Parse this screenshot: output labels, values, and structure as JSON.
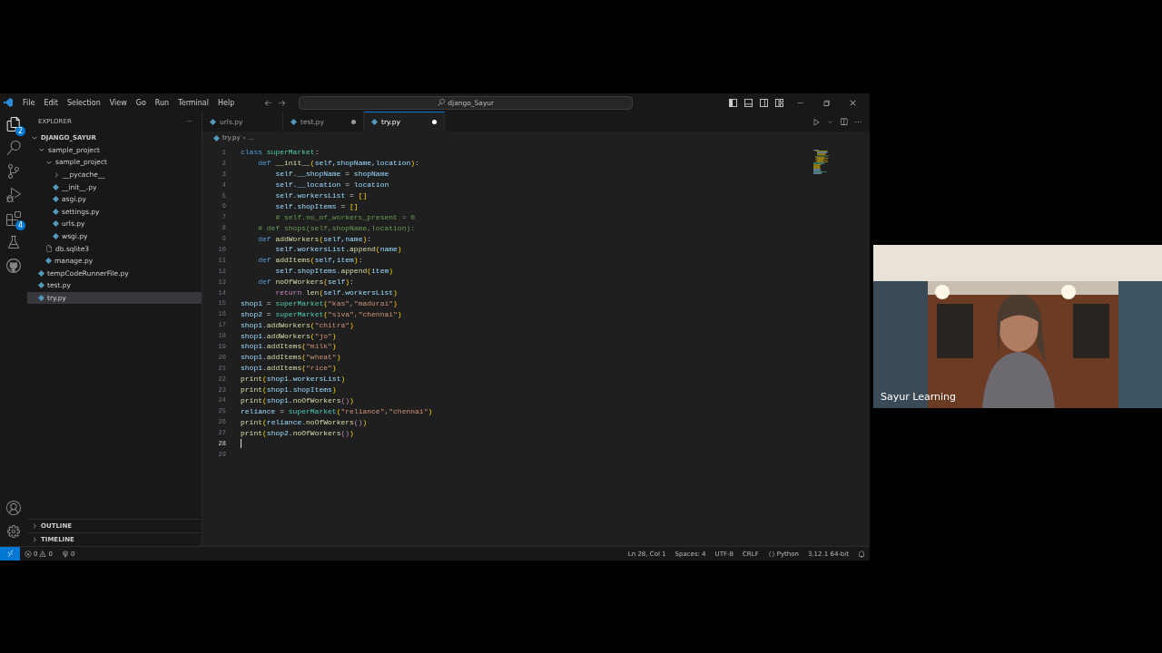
{
  "menu": [
    "File",
    "Edit",
    "Selection",
    "View",
    "Go",
    "Run",
    "Terminal",
    "Help"
  ],
  "command_center": {
    "value": "django_Sayur"
  },
  "activity_bar": [
    {
      "kind": "files",
      "selected": true,
      "badge": "2"
    },
    {
      "kind": "search",
      "selected": false
    },
    {
      "kind": "source-control",
      "selected": false
    },
    {
      "kind": "run-debug",
      "selected": false
    },
    {
      "kind": "extensions",
      "selected": false,
      "badge": "4"
    },
    {
      "kind": "testing",
      "selected": false
    },
    {
      "kind": "github",
      "selected": false
    }
  ],
  "explorer": {
    "title": "EXPLORER",
    "more": "···",
    "tree": [
      {
        "label": "DJANGO_SAYUR",
        "kind": "root",
        "expanded": true,
        "selected": false,
        "children": [
          {
            "label": "sample_project",
            "kind": "folder",
            "expanded": true,
            "selected": false,
            "children": [
              {
                "label": "sample_project",
                "kind": "folder",
                "expanded": true,
                "selected": false,
                "children": [
                  {
                    "label": "__pycache__",
                    "kind": "folder",
                    "expanded": false,
                    "selected": false
                  },
                  {
                    "label": "__init__.py",
                    "kind": "py",
                    "selected": false
                  },
                  {
                    "label": "asgi.py",
                    "kind": "py",
                    "selected": false
                  },
                  {
                    "label": "settings.py",
                    "kind": "py",
                    "selected": false
                  },
                  {
                    "label": "urls.py",
                    "kind": "py",
                    "selected": false
                  },
                  {
                    "label": "wsgi.py",
                    "kind": "py",
                    "selected": false
                  }
                ]
              },
              {
                "label": "db.sqlite3",
                "kind": "db",
                "selected": false
              },
              {
                "label": "manage.py",
                "kind": "py",
                "selected": false
              }
            ]
          },
          {
            "label": "tempCodeRunnerFile.py",
            "kind": "py",
            "selected": false
          },
          {
            "label": "test.py",
            "kind": "py",
            "selected": false
          },
          {
            "label": "try.py",
            "kind": "py",
            "selected": true
          }
        ]
      }
    ]
  },
  "sections": [
    {
      "label": "OUTLINE",
      "expanded": false
    },
    {
      "label": "TIMELINE",
      "expanded": false
    }
  ],
  "tabs": [
    {
      "label": "urls.py",
      "selected": false,
      "dirty": false
    },
    {
      "label": "test.py",
      "selected": false,
      "dirty": true
    },
    {
      "label": "try.py",
      "selected": true,
      "dirty": true
    }
  ],
  "breadcrumb": [
    "try.py",
    "›",
    "..."
  ],
  "code": [
    {
      "number": "1",
      "current": false,
      "tokens": [
        {
          "kind": "kw",
          "text": "class "
        },
        {
          "kind": "cls",
          "text": "superMarket"
        },
        {
          "kind": "plain",
          "text": ":"
        }
      ]
    },
    {
      "number": "2",
      "current": false,
      "tokens": [
        {
          "kind": "kw",
          "text": "    def "
        },
        {
          "kind": "fn",
          "text": "__init__"
        },
        {
          "kind": "br",
          "text": "("
        },
        {
          "kind": "var",
          "text": "self,shopName,location"
        },
        {
          "kind": "br",
          "text": ")"
        },
        {
          "kind": "plain",
          "text": ":"
        }
      ]
    },
    {
      "number": "3",
      "current": false,
      "tokens": [
        {
          "kind": "var",
          "text": "        self.__shopName"
        },
        {
          "kind": "plain",
          "text": " = "
        },
        {
          "kind": "var",
          "text": "shopName"
        }
      ]
    },
    {
      "number": "4",
      "current": false,
      "tokens": [
        {
          "kind": "var",
          "text": "        self.__location"
        },
        {
          "kind": "plain",
          "text": " = "
        },
        {
          "kind": "var",
          "text": "location"
        }
      ]
    },
    {
      "number": "5",
      "current": false,
      "tokens": [
        {
          "kind": "var",
          "text": "        self.workersList"
        },
        {
          "kind": "plain",
          "text": " = "
        },
        {
          "kind": "br",
          "text": "[]"
        }
      ]
    },
    {
      "number": "6",
      "current": false,
      "tokens": [
        {
          "kind": "var",
          "text": "        self.shopItems"
        },
        {
          "kind": "plain",
          "text": " = "
        },
        {
          "kind": "br",
          "text": "[]"
        }
      ]
    },
    {
      "number": "7",
      "current": false,
      "tokens": [
        {
          "kind": "comment",
          "text": "        # self.no_of_workers_present = 0"
        }
      ]
    },
    {
      "number": "8",
      "current": false,
      "tokens": [
        {
          "kind": "comment",
          "text": "    # def shops(self,shopName,location):"
        }
      ]
    },
    {
      "number": "9",
      "current": false,
      "tokens": [
        {
          "kind": "kw",
          "text": "    def "
        },
        {
          "kind": "fn",
          "text": "addWorkers"
        },
        {
          "kind": "br",
          "text": "("
        },
        {
          "kind": "var",
          "text": "self,name"
        },
        {
          "kind": "br",
          "text": ")"
        },
        {
          "kind": "plain",
          "text": ":"
        }
      ]
    },
    {
      "number": "10",
      "current": false,
      "tokens": [
        {
          "kind": "var",
          "text": "        self.workersList."
        },
        {
          "kind": "fn",
          "text": "append"
        },
        {
          "kind": "br",
          "text": "("
        },
        {
          "kind": "var",
          "text": "name"
        },
        {
          "kind": "br",
          "text": ")"
        }
      ]
    },
    {
      "number": "11",
      "current": false,
      "tokens": [
        {
          "kind": "kw",
          "text": "    def "
        },
        {
          "kind": "fn",
          "text": "addItems"
        },
        {
          "kind": "br",
          "text": "("
        },
        {
          "kind": "var",
          "text": "self,item"
        },
        {
          "kind": "br",
          "text": ")"
        },
        {
          "kind": "plain",
          "text": ":"
        }
      ]
    },
    {
      "number": "12",
      "current": false,
      "tokens": [
        {
          "kind": "var",
          "text": "        self.shopItems."
        },
        {
          "kind": "fn",
          "text": "append"
        },
        {
          "kind": "br",
          "text": "("
        },
        {
          "kind": "var",
          "text": "item"
        },
        {
          "kind": "br",
          "text": ")"
        }
      ]
    },
    {
      "number": "13",
      "current": false,
      "tokens": [
        {
          "kind": "kw",
          "text": "    def "
        },
        {
          "kind": "fn",
          "text": "noOfWorkers"
        },
        {
          "kind": "br",
          "text": "("
        },
        {
          "kind": "var",
          "text": "self"
        },
        {
          "kind": "br",
          "text": ")"
        },
        {
          "kind": "plain",
          "text": ":"
        }
      ]
    },
    {
      "number": "14",
      "current": false,
      "tokens": [
        {
          "kind": "ctl",
          "text": "        return "
        },
        {
          "kind": "fn",
          "text": "len"
        },
        {
          "kind": "br",
          "text": "("
        },
        {
          "kind": "var",
          "text": "self.workersList"
        },
        {
          "kind": "br",
          "text": ")"
        }
      ]
    },
    {
      "number": "15",
      "current": false,
      "tokens": [
        {
          "kind": "var",
          "text": "shop1"
        },
        {
          "kind": "plain",
          "text": " = "
        },
        {
          "kind": "cls",
          "text": "superMarket"
        },
        {
          "kind": "br",
          "text": "("
        },
        {
          "kind": "str",
          "text": "\"kas\",\"madurai\""
        },
        {
          "kind": "br",
          "text": ")"
        }
      ]
    },
    {
      "number": "16",
      "current": false,
      "tokens": [
        {
          "kind": "var",
          "text": "shop2"
        },
        {
          "kind": "plain",
          "text": " = "
        },
        {
          "kind": "cls",
          "text": "superMarket"
        },
        {
          "kind": "br",
          "text": "("
        },
        {
          "kind": "str",
          "text": "\"siva\",\"chennai\""
        },
        {
          "kind": "br",
          "text": ")"
        }
      ]
    },
    {
      "number": "17",
      "current": false,
      "tokens": [
        {
          "kind": "var",
          "text": "shop1."
        },
        {
          "kind": "fn",
          "text": "addWorkers"
        },
        {
          "kind": "br",
          "text": "("
        },
        {
          "kind": "str",
          "text": "\"chitra\""
        },
        {
          "kind": "br",
          "text": ")"
        }
      ]
    },
    {
      "number": "18",
      "current": false,
      "tokens": [
        {
          "kind": "var",
          "text": "shop1."
        },
        {
          "kind": "fn",
          "text": "addWorkers"
        },
        {
          "kind": "br",
          "text": "("
        },
        {
          "kind": "str",
          "text": "\"jo\""
        },
        {
          "kind": "br",
          "text": ")"
        }
      ]
    },
    {
      "number": "19",
      "current": false,
      "tokens": [
        {
          "kind": "var",
          "text": "shop1."
        },
        {
          "kind": "fn",
          "text": "addItems"
        },
        {
          "kind": "br",
          "text": "("
        },
        {
          "kind": "str",
          "text": "\"milk\""
        },
        {
          "kind": "br",
          "text": ")"
        }
      ]
    },
    {
      "number": "20",
      "current": false,
      "tokens": [
        {
          "kind": "var",
          "text": "shop1."
        },
        {
          "kind": "fn",
          "text": "addItems"
        },
        {
          "kind": "br",
          "text": "("
        },
        {
          "kind": "str",
          "text": "\"wheat\""
        },
        {
          "kind": "br",
          "text": ")"
        }
      ]
    },
    {
      "number": "21",
      "current": false,
      "tokens": [
        {
          "kind": "var",
          "text": "shop1."
        },
        {
          "kind": "fn",
          "text": "addItems"
        },
        {
          "kind": "br",
          "text": "("
        },
        {
          "kind": "str",
          "text": "\"rice\""
        },
        {
          "kind": "br",
          "text": ")"
        }
      ]
    },
    {
      "number": "22",
      "current": false,
      "tokens": [
        {
          "kind": "fn",
          "text": "print"
        },
        {
          "kind": "br",
          "text": "("
        },
        {
          "kind": "var",
          "text": "shop1.workersList"
        },
        {
          "kind": "br",
          "text": ")"
        }
      ]
    },
    {
      "number": "23",
      "current": false,
      "tokens": [
        {
          "kind": "fn",
          "text": "print"
        },
        {
          "kind": "br",
          "text": "("
        },
        {
          "kind": "var",
          "text": "shop1.shopItems"
        },
        {
          "kind": "br",
          "text": ")"
        }
      ]
    },
    {
      "number": "24",
      "current": false,
      "tokens": [
        {
          "kind": "fn",
          "text": "print"
        },
        {
          "kind": "br",
          "text": "("
        },
        {
          "kind": "var",
          "text": "shop1."
        },
        {
          "kind": "fn",
          "text": "noOfWorkers"
        },
        {
          "kind": "ctl",
          "text": "()"
        },
        {
          "kind": "br",
          "text": ")"
        }
      ]
    },
    {
      "number": "25",
      "current": false,
      "tokens": [
        {
          "kind": "var",
          "text": "reliance"
        },
        {
          "kind": "plain",
          "text": " = "
        },
        {
          "kind": "cls",
          "text": "superMarket"
        },
        {
          "kind": "br",
          "text": "("
        },
        {
          "kind": "str",
          "text": "\"reliance\",\"chennai\""
        },
        {
          "kind": "br",
          "text": ")"
        }
      ]
    },
    {
      "number": "26",
      "current": false,
      "tokens": [
        {
          "kind": "fn",
          "text": "print"
        },
        {
          "kind": "br",
          "text": "("
        },
        {
          "kind": "var",
          "text": "reliance."
        },
        {
          "kind": "fn",
          "text": "noOfWorkers"
        },
        {
          "kind": "ctl",
          "text": "()"
        },
        {
          "kind": "br",
          "text": ")"
        }
      ]
    },
    {
      "number": "27",
      "current": false,
      "tokens": [
        {
          "kind": "fn",
          "text": "print"
        },
        {
          "kind": "br",
          "text": "("
        },
        {
          "kind": "var",
          "text": "shop2."
        },
        {
          "kind": "fn",
          "text": "noOfWorkers"
        },
        {
          "kind": "ctl",
          "text": "()"
        },
        {
          "kind": "br",
          "text": ")"
        }
      ]
    },
    {
      "number": "28",
      "current": true
    },
    {
      "number": "29",
      "current": false
    }
  ],
  "status_bar": {
    "errors": "0",
    "warnings": "0",
    "ports": "0",
    "right": [
      {
        "kind": "text",
        "label": "Ln 28, Col 1"
      },
      {
        "kind": "text",
        "label": "Spaces: 4"
      },
      {
        "kind": "text",
        "label": "UTF-8"
      },
      {
        "kind": "text",
        "label": "CRLF"
      },
      {
        "kind": "language",
        "label": "Python"
      },
      {
        "kind": "text",
        "label": "3.12.1 64-bit"
      }
    ]
  },
  "video": {
    "kind": "picture",
    "name": "Sayur Learning"
  }
}
